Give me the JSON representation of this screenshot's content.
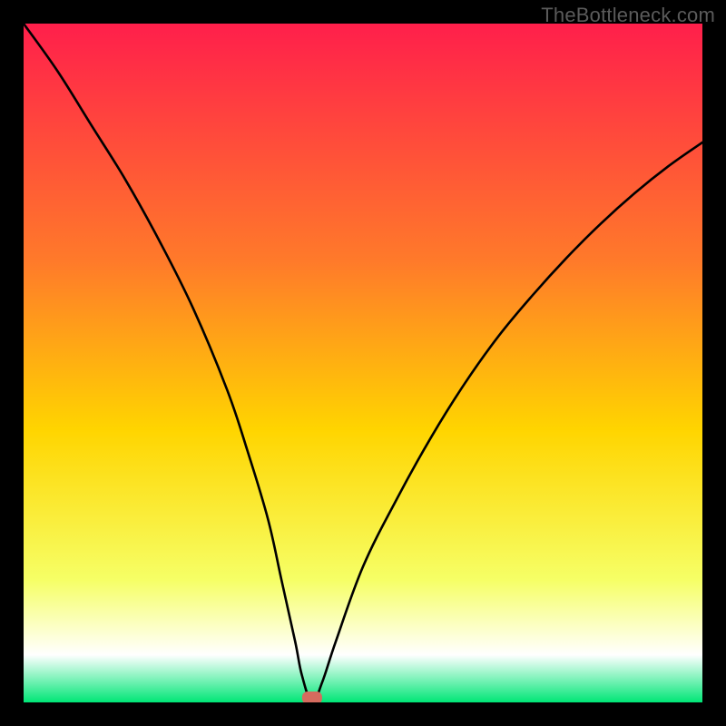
{
  "watermark": "TheBottleneck.com",
  "chart_data": {
    "type": "line",
    "title": "",
    "xlabel": "",
    "ylabel": "",
    "xlim": [
      0,
      100
    ],
    "ylim": [
      0,
      100
    ],
    "annotations": [],
    "marker": {
      "x": 42.5,
      "y": 0,
      "color": "#d56b5e"
    },
    "series": [
      {
        "name": "curve",
        "color": "#000000",
        "x": [
          0,
          5,
          10,
          15,
          20,
          25,
          30,
          33,
          36,
          38,
          40,
          41,
          42.5,
          44,
          46,
          50,
          55,
          60,
          65,
          70,
          75,
          80,
          85,
          90,
          95,
          100
        ],
        "values": [
          100,
          93,
          85,
          77,
          68,
          58,
          46,
          37,
          27,
          18,
          9,
          4,
          0,
          3,
          9,
          20,
          30,
          39,
          47,
          54,
          60,
          65.5,
          70.5,
          75,
          79,
          82.5
        ]
      }
    ],
    "palette": {
      "gradient_top": "#ff1f4b",
      "gradient_mid_upper": "#ff7a2a",
      "gradient_mid": "#ffd500",
      "gradient_mid_lower": "#f6ff66",
      "gradient_lower": "#ffffff",
      "gradient_bottom": "#00e676",
      "frame": "#000000"
    }
  }
}
